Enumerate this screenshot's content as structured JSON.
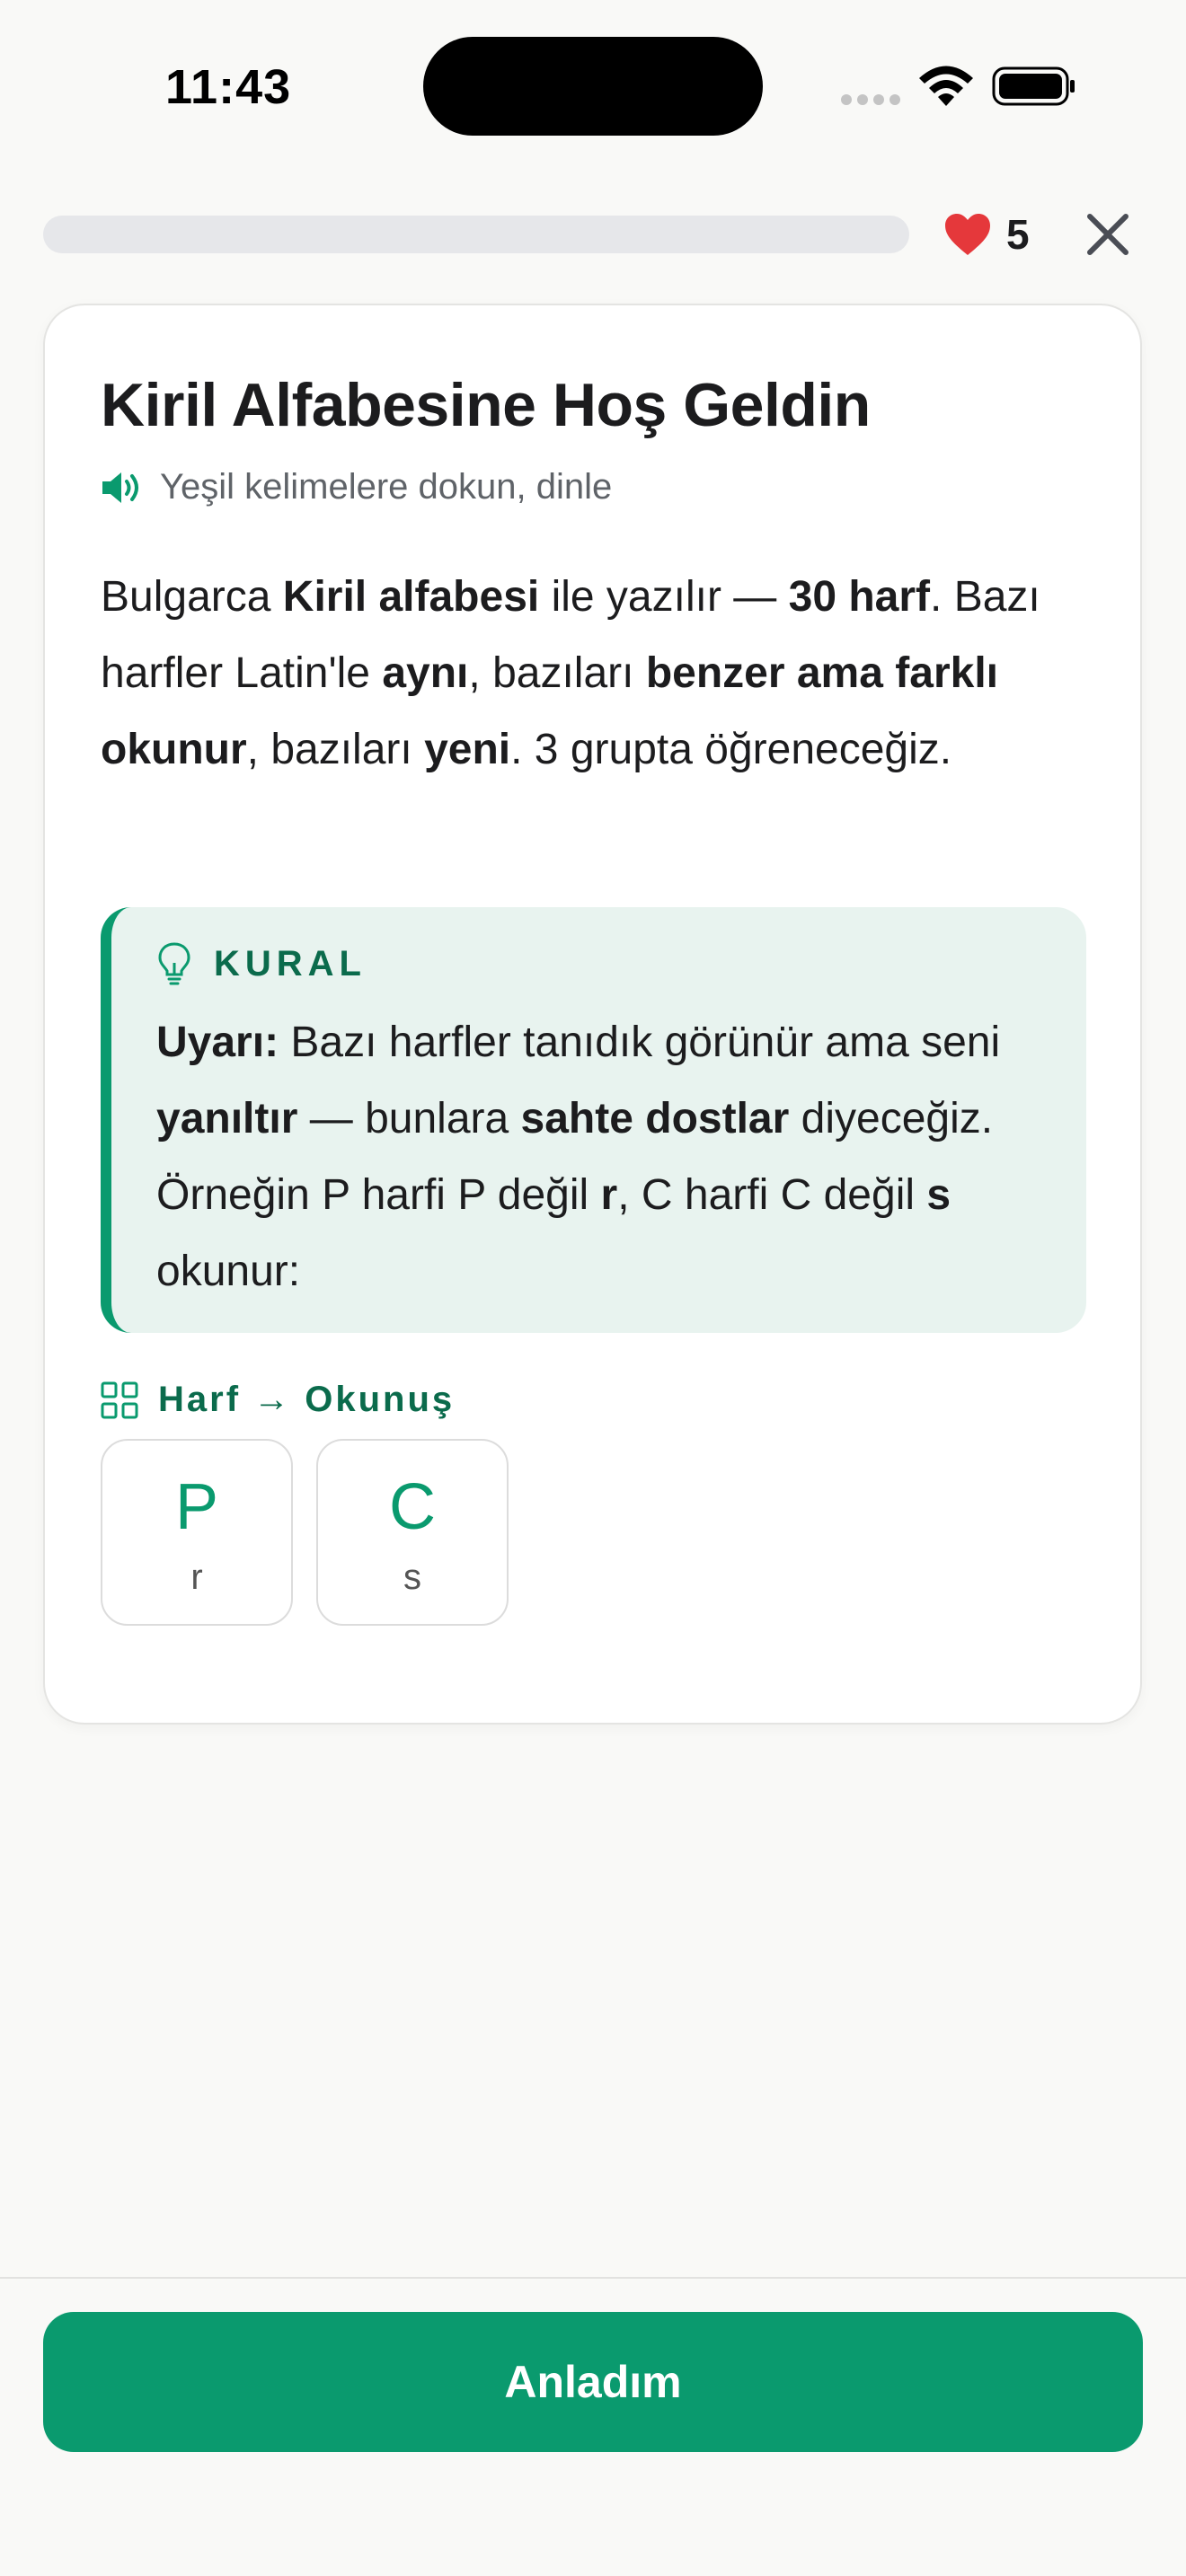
{
  "status_bar": {
    "time": "11:43"
  },
  "lesson": {
    "progress_percent": 0,
    "lives": "5",
    "accent_color": "#0a9a6e",
    "heart_color": "#e5383b"
  },
  "card": {
    "title": "Kiril Alfabesine Hoş Geldin",
    "hint": "Yeşil kelimelere dokun, dinle",
    "body": [
      {
        "text": "Bulgarca ",
        "bold": false
      },
      {
        "text": "Kiril alfabesi",
        "bold": true
      },
      {
        "text": " ile yazılır — ",
        "bold": false
      },
      {
        "text": "30 harf",
        "bold": true
      },
      {
        "text": ". Bazı harfler Latin'le ",
        "bold": false
      },
      {
        "text": "aynı",
        "bold": true
      },
      {
        "text": ", bazıları ",
        "bold": false
      },
      {
        "text": "benzer ama farklı okunur",
        "bold": true
      },
      {
        "text": ", bazıları ",
        "bold": false
      },
      {
        "text": "yeni",
        "bold": true
      },
      {
        "text": ". 3 grupta öğreneceğiz.",
        "bold": false
      }
    ],
    "rule": {
      "label": "KURAL",
      "text": [
        {
          "text": "Uyarı:",
          "bold": true
        },
        {
          "text": " Bazı harfler tanıdık görünür ama seni ",
          "bold": false
        },
        {
          "text": "yanıltır",
          "bold": true
        },
        {
          "text": " — bunlara ",
          "bold": false
        },
        {
          "text": "sahte dostlar",
          "bold": true
        },
        {
          "text": " diyeceğiz. Örneğin P harfi P değil ",
          "bold": false
        },
        {
          "text": "r",
          "bold": true
        },
        {
          "text": ", C harfi C değil ",
          "bold": false
        },
        {
          "text": "s",
          "bold": true
        },
        {
          "text": " okunur:",
          "bold": false
        }
      ]
    },
    "table": {
      "title": "Harf → Okunuş",
      "letters": [
        {
          "letter": "P",
          "reading": "r"
        },
        {
          "letter": "C",
          "reading": "s"
        }
      ]
    }
  },
  "footer": {
    "button_label": "Anladım"
  }
}
